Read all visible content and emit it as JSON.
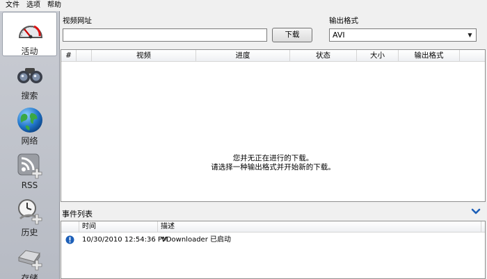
{
  "menu": {
    "file": "文件",
    "options": "选项",
    "help": "帮助"
  },
  "sidebar": {
    "items": [
      {
        "label": "活动",
        "icon": "gauge-icon",
        "active": true
      },
      {
        "label": "搜索",
        "icon": "binoculars-icon",
        "active": false
      },
      {
        "label": "网络",
        "icon": "globe-icon",
        "active": false
      },
      {
        "label": "RSS",
        "icon": "rss-icon",
        "active": false
      },
      {
        "label": "历史",
        "icon": "clock-icon",
        "active": false
      },
      {
        "label": "存储",
        "icon": "hard-drive-icon",
        "active": false
      }
    ]
  },
  "url": {
    "label": "视频网址",
    "value": "",
    "download_label": "下载"
  },
  "format": {
    "label": "输出格式",
    "selected": "AVI"
  },
  "downloads": {
    "columns": [
      "#",
      "",
      "视频",
      "进度",
      "状态",
      "大小",
      "输出格式"
    ],
    "empty_line1": "您并无正在进行的下载。",
    "empty_line2": "请选择一种输出格式并开始新的下载。"
  },
  "events": {
    "title": "事件列表",
    "columns": [
      "时间",
      "描述"
    ],
    "rows": [
      {
        "icon": "info-icon",
        "time": "10/30/2010 12:54:36 PM",
        "description": "VDownloader 已启动"
      }
    ]
  },
  "colors": {
    "sidebar": "#c0c3ca",
    "accent": "#1c5fb8"
  }
}
